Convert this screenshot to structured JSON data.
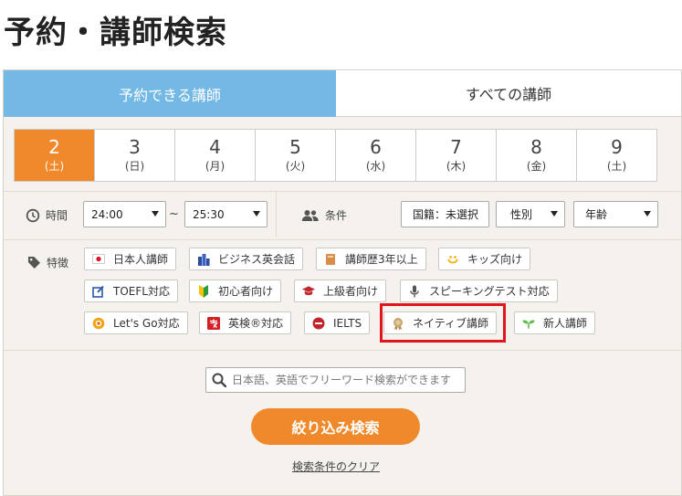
{
  "page": {
    "title": "予約・講師検索"
  },
  "tabs": [
    {
      "label": "予約できる講師",
      "active": true
    },
    {
      "label": "すべての講師",
      "active": false
    }
  ],
  "days": [
    {
      "num": "2",
      "weekday": "(土)",
      "selected": true
    },
    {
      "num": "3",
      "weekday": "(日)"
    },
    {
      "num": "4",
      "weekday": "(月)"
    },
    {
      "num": "5",
      "weekday": "(火)"
    },
    {
      "num": "6",
      "weekday": "(水)"
    },
    {
      "num": "7",
      "weekday": "(木)"
    },
    {
      "num": "8",
      "weekday": "(金)"
    },
    {
      "num": "9",
      "weekday": "(土)"
    }
  ],
  "time": {
    "label": "時間",
    "start": "24:00",
    "separator": "~",
    "end": "25:30"
  },
  "conditions": {
    "label": "条件",
    "nationality": "国籍：未選択",
    "gender": "性別",
    "age": "年齢"
  },
  "features": {
    "label": "特徴",
    "chips": [
      {
        "label": "日本人講師",
        "icon": "japan-flag-icon"
      },
      {
        "label": "ビジネス英会話",
        "icon": "building-icon"
      },
      {
        "label": "講師歴3年以上",
        "icon": "book-icon"
      },
      {
        "label": "キッズ向け",
        "icon": "smile-icon"
      },
      {
        "label": "TOEFL対応",
        "icon": "edit-icon"
      },
      {
        "label": "初心者向け",
        "icon": "beginner-mark-icon"
      },
      {
        "label": "上級者向け",
        "icon": "graduation-cap-icon"
      },
      {
        "label": "スピーキングテスト対応",
        "icon": "microphone-icon"
      },
      {
        "label": "Let's Go対応",
        "icon": "lets-go-icon"
      },
      {
        "label": "英検®対応",
        "icon": "eiken-icon"
      },
      {
        "label": "IELTS",
        "icon": "ielts-icon"
      },
      {
        "label": "ネイティブ講師",
        "icon": "native-badge-icon",
        "highlighted": true
      },
      {
        "label": "新人講師",
        "icon": "sprout-icon"
      }
    ]
  },
  "search": {
    "placeholder": "日本語、英語でフリーワード検索ができます"
  },
  "submit_label": "絞り込み検索",
  "clear_label": "検索条件のクリア",
  "colors": {
    "accent": "#f0892b",
    "tab_active": "#74b8e6",
    "highlight": "#e0161d"
  }
}
